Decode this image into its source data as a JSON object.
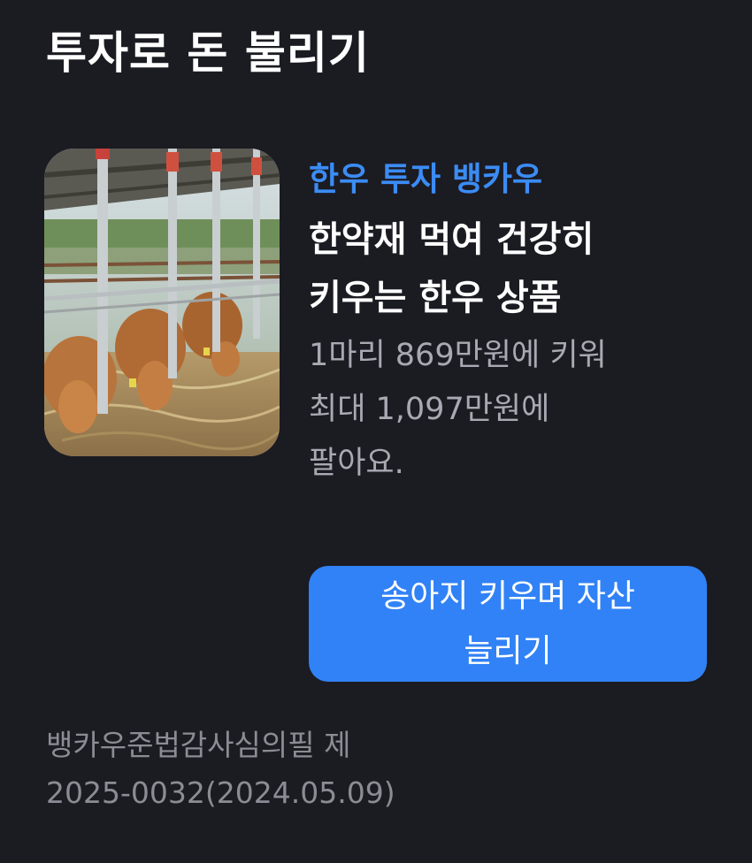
{
  "section": {
    "title": "투자로 돈 불리기"
  },
  "card": {
    "image": "cattle-farm-photo",
    "brand": "한우 투자 뱅카우",
    "headline_line1": "한약재 먹여 건강히",
    "headline_line2": "키우는 한우 상품",
    "desc_line1": "1마리 869만원에 키워",
    "desc_line2": "최대 1,097만원에",
    "desc_line3": "팔아요.",
    "cta_line1": "송아지 키우며 자산",
    "cta_line2": "늘리기"
  },
  "disclaimer": {
    "line1": "뱅카우준법감사심의필 제",
    "line2": "2025-0032(2024.05.09)"
  },
  "colors": {
    "background": "#1b1b22",
    "brand": "#3b8cf4",
    "button": "#3182f6",
    "muted": "#a9a9b3"
  }
}
